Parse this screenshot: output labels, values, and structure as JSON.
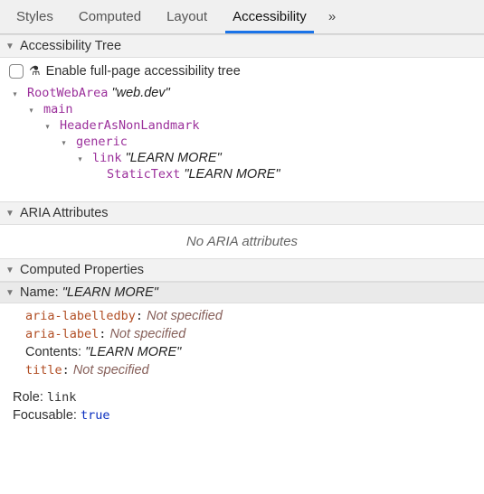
{
  "tabs": {
    "styles": "Styles",
    "computed": "Computed",
    "layout": "Layout",
    "accessibility": "Accessibility",
    "overflow": "»"
  },
  "sections": {
    "tree_header": "Accessibility Tree",
    "aria_header": "ARIA Attributes",
    "computed_header": "Computed Properties"
  },
  "enable": {
    "label": "Enable full-page accessibility tree",
    "flask": "⚗"
  },
  "tree": {
    "n0": {
      "role": "RootWebArea",
      "name": "\"web.dev\""
    },
    "n1": {
      "role": "main"
    },
    "n2": {
      "role": "HeaderAsNonLandmark"
    },
    "n3": {
      "role": "generic"
    },
    "n4": {
      "role": "link",
      "name": "\"LEARN MORE\""
    },
    "n5": {
      "role": "StaticText",
      "name": "\"LEARN MORE\""
    }
  },
  "aria": {
    "empty": "No ARIA attributes"
  },
  "computed": {
    "name_label": "Name:",
    "name_value": "\"LEARN MORE\"",
    "aria_labelledby_k": "aria-labelledby",
    "aria_labelledby_v": "Not specified",
    "aria_label_k": "aria-label",
    "aria_label_v": "Not specified",
    "contents_k": "Contents:",
    "contents_v": "\"LEARN MORE\"",
    "title_k": "title",
    "title_v": "Not specified",
    "role_k": "Role:",
    "role_v": "link",
    "focusable_k": "Focusable:",
    "focusable_v": "true",
    "colon": ":"
  }
}
